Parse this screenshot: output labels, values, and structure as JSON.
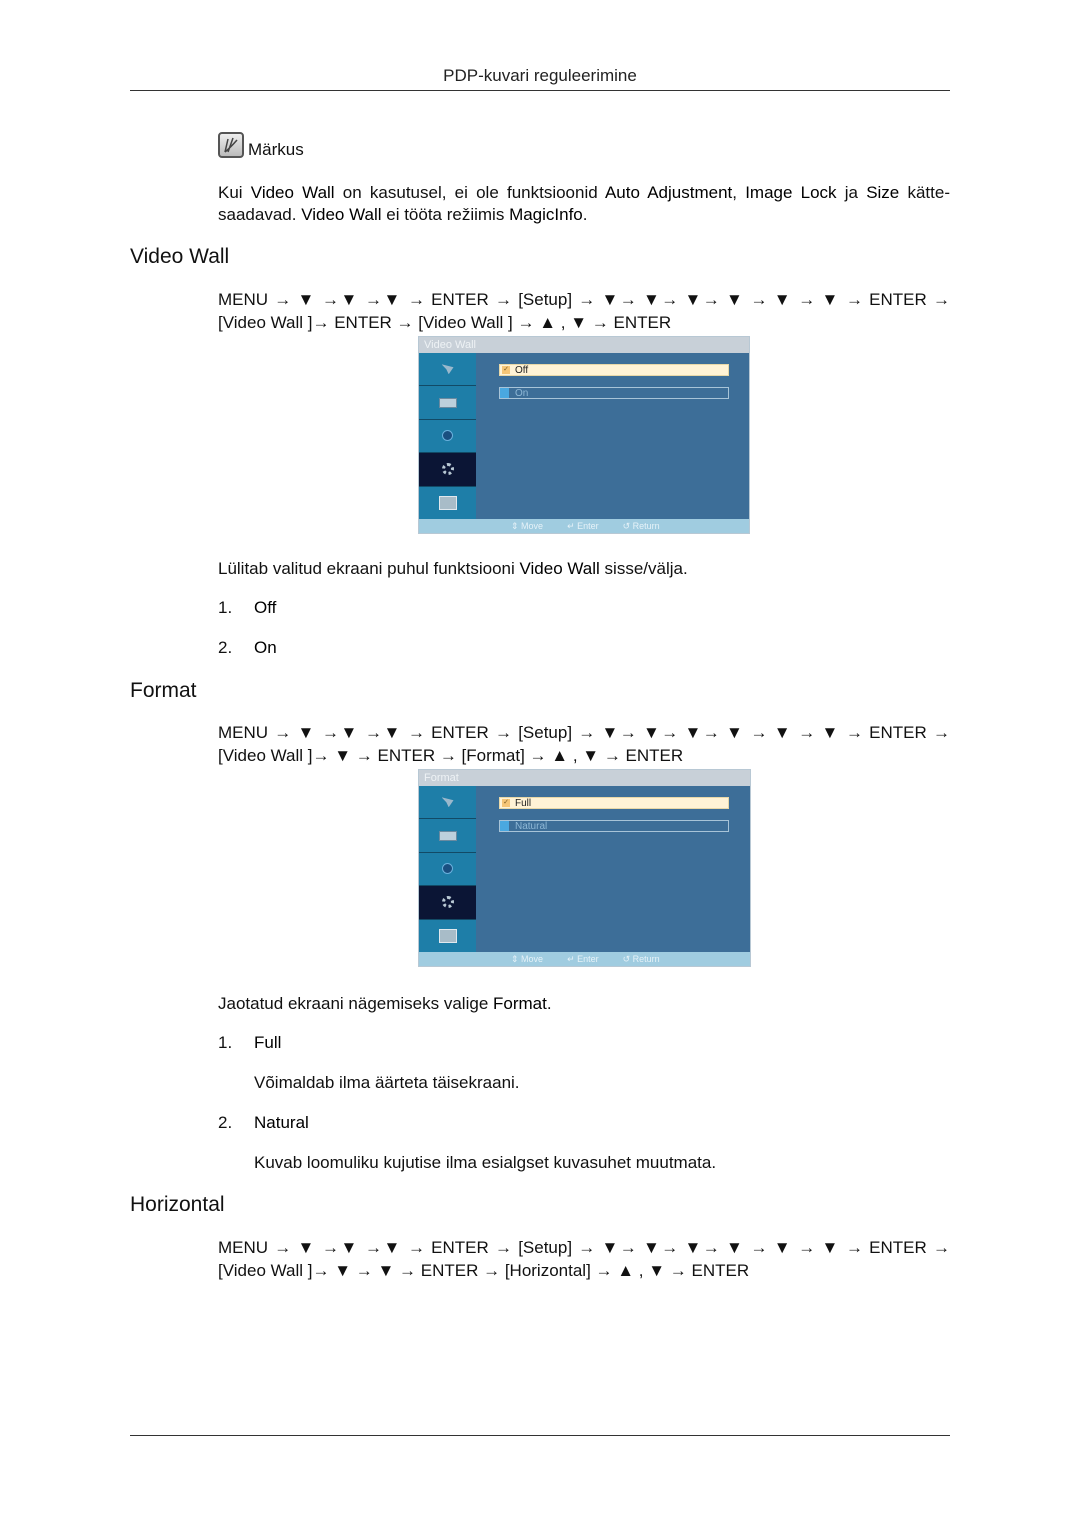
{
  "header": {
    "running_title": "PDP-kuvari reguleerimine"
  },
  "note": {
    "icon": "note-pencil-icon",
    "title": "Märkus",
    "body_parts": [
      {
        "t": "Kui ",
        "b": false
      },
      {
        "t": "Video Wall",
        "b": true
      },
      {
        "t": " on kasutusel, ei ole funktsioonid ",
        "b": false
      },
      {
        "t": "Auto Adjustment",
        "b": true
      },
      {
        "t": ", ",
        "b": false
      },
      {
        "t": "Image Lock",
        "b": true
      },
      {
        "t": " ja ",
        "b": false
      },
      {
        "t": "Size",
        "b": true
      },
      {
        "t": " kätte-saadavad. ",
        "b": false
      },
      {
        "t": "Video Wall",
        "b": true
      },
      {
        "t": " ei tööta režiimis ",
        "b": false
      },
      {
        "t": "MagicInfo",
        "b": true
      },
      {
        "t": ".",
        "b": false
      }
    ]
  },
  "sections": [
    {
      "title": "Video Wall",
      "path": "MENU → ▼ →▼ →▼ → ENTER → [Setup] → ▼→ ▼→ ▼→ ▼ → ▼ → ▼ → ENTER → [Video Wall ]→ ENTER → [Video Wall ] → ▲ , ▼ → ENTER",
      "osd": {
        "title": "Video Wall",
        "options": [
          {
            "label": "Off",
            "selected": true
          },
          {
            "label": "On",
            "selected": false
          }
        ],
        "footer": [
          "Move",
          "Enter",
          "Return"
        ]
      },
      "description_parts": [
        {
          "t": "Lülitab valitud ekraani puhul funktsiooni ",
          "b": false
        },
        {
          "t": "Video Wall",
          "b": true
        },
        {
          "t": " sisse/välja.",
          "b": false
        }
      ],
      "items": [
        {
          "num": "1.",
          "label": "Off"
        },
        {
          "num": "2.",
          "label": "On"
        }
      ]
    },
    {
      "title": "Format",
      "path": "MENU → ▼ →▼ →▼ → ENTER → [Setup] → ▼→ ▼→ ▼→ ▼ → ▼ → ▼ → ENTER → [Video Wall ]→ ▼ → ENTER → [Format] → ▲ , ▼ → ENTER",
      "osd": {
        "title": "Format",
        "options": [
          {
            "label": "Full",
            "selected": true
          },
          {
            "label": "Natural",
            "selected": false
          }
        ],
        "footer": [
          "Move",
          "Enter",
          "Return"
        ]
      },
      "description_parts": [
        {
          "t": "Jaotatud ekraani nägemiseks valige ",
          "b": false
        },
        {
          "t": "Format",
          "b": true
        },
        {
          "t": ".",
          "b": false
        }
      ],
      "items": [
        {
          "num": "1.",
          "label": "Full",
          "desc": "Võimaldab ilma äärteta täisekraani."
        },
        {
          "num": "2.",
          "label": "Natural",
          "desc": "Kuvab loomuliku kujutise ilma esialgset kuvasuhet muutmata."
        }
      ]
    },
    {
      "title": "Horizontal",
      "path": "MENU → ▼ →▼ →▼ → ENTER → [Setup] → ▼→ ▼→ ▼→ ▼ → ▼ → ▼ → ENTER → [Video Wall ]→ ▼ → ▼ → ENTER → [Horizontal] → ▲ , ▼ → ENTER"
    }
  ],
  "osd_sidebar_icons": [
    "antenna-icon",
    "picture-icon",
    "sound-icon",
    "setup-gear-icon",
    "input-icon"
  ],
  "osd_active_tab": "setup-gear-icon",
  "osd_footer_icons": [
    "move-arrows-icon",
    "enter-icon",
    "return-icon"
  ]
}
